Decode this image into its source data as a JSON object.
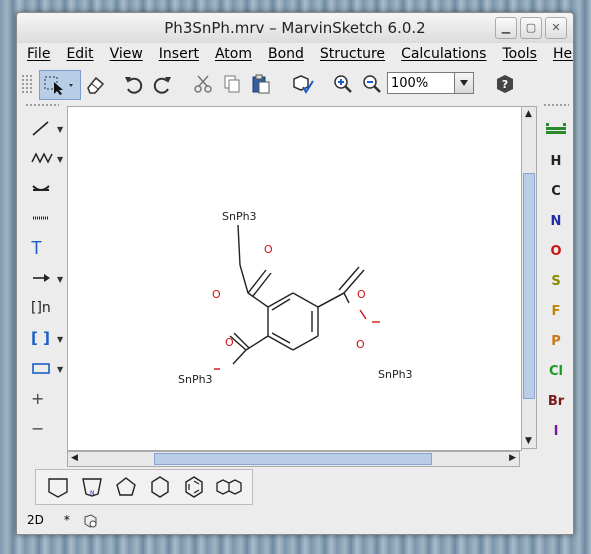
{
  "window": {
    "title": "Ph3SnPh.mrv – MarvinSketch 6.0.2",
    "controls": [
      "▁",
      "▢",
      "✕"
    ]
  },
  "menu": [
    "File",
    "Edit",
    "View",
    "Insert",
    "Atom",
    "Bond",
    "Structure",
    "Calculations",
    "Tools",
    "Help"
  ],
  "toolbar": {
    "zoom_value": "100%",
    "icons": [
      "select-icon",
      "eraser-icon",
      "undo-icon",
      "redo-icon",
      "cut-icon",
      "copy-icon",
      "paste-icon",
      "clean-2d-icon",
      "zoom-in-icon",
      "zoom-out-icon",
      "help-icon"
    ]
  },
  "left_tools": [
    {
      "icon": "single-bond-icon",
      "dropdown": true
    },
    {
      "icon": "chain-icon",
      "dropdown": true
    },
    {
      "icon": "arc-icon",
      "dropdown": false
    },
    {
      "icon": "dashed-line-icon",
      "dropdown": false
    },
    {
      "icon": "text-icon",
      "glyph": "T",
      "dropdown": false
    },
    {
      "icon": "arrow-icon",
      "dropdown": true
    },
    {
      "icon": "repeating-unit-icon",
      "glyph": "[]n",
      "dropdown": false
    },
    {
      "icon": "bracket-icon",
      "glyph": "[ ]",
      "dropdown": true
    },
    {
      "icon": "rectangle-icon",
      "dropdown": true
    },
    {
      "icon": "plus-icon",
      "glyph": "+",
      "dropdown": false
    },
    {
      "icon": "minus-icon",
      "glyph": "−",
      "dropdown": false
    }
  ],
  "elements": [
    {
      "symbol": "H",
      "color": "#222222"
    },
    {
      "symbol": "C",
      "color": "#222222"
    },
    {
      "symbol": "N",
      "color": "#1e2ea8"
    },
    {
      "symbol": "O",
      "color": "#d01010"
    },
    {
      "symbol": "S",
      "color": "#8a8a00"
    },
    {
      "symbol": "F",
      "color": "#b8860b"
    },
    {
      "symbol": "P",
      "color": "#c8781a"
    },
    {
      "symbol": "Cl",
      "color": "#1a9a1a"
    },
    {
      "symbol": "Br",
      "color": "#7a1a1a"
    },
    {
      "symbol": "I",
      "color": "#7a1a9a"
    }
  ],
  "molecule": {
    "labels": {
      "sn_top": "SnPh3",
      "sn_left": "SnPh3",
      "sn_right": "SnPh3",
      "o_ketone": "O",
      "o_ester_left_carbonyl": "O",
      "o_ester_left_link": "O",
      "o_ester_right_carbonyl": "O",
      "o_ester_right_link": "O"
    }
  },
  "shapes": [
    "pyran-icon",
    "pyrrole-icon",
    "cyclopentane-icon",
    "cyclohexane-icon",
    "benzene-icon",
    "naphthalene-icon"
  ],
  "status": {
    "mode": "2D",
    "modified": "*"
  }
}
